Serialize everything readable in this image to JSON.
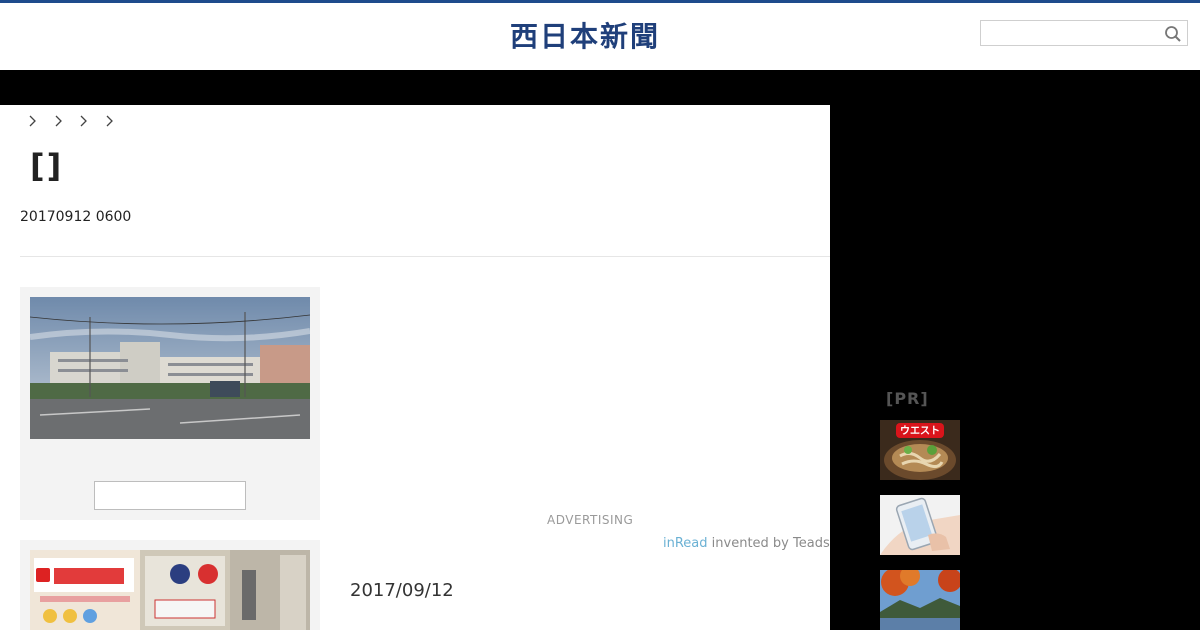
{
  "header": {
    "logo_text": "西日本新聞",
    "search": {
      "value": "",
      "placeholder": ""
    }
  },
  "breadcrumb": {
    "separators": 4
  },
  "article": {
    "title": "[]",
    "published": "20170912 0600"
  },
  "advertising": {
    "label": "ADVERTISING",
    "inread_brand": "inRead",
    "inread_suffix": " invented by Teads"
  },
  "article_list": {
    "date": "2017/09/12"
  },
  "sidebar": {
    "pr_label": "[PR]",
    "thumbnails": [
      {
        "badge_text": "ウエスト"
      },
      {
        "badge_text": ""
      },
      {
        "badge_text": ""
      }
    ]
  },
  "colors": {
    "brand_blue": "#1e4b8c",
    "nav_black": "#000000",
    "card_gray": "#f3f3f3"
  }
}
